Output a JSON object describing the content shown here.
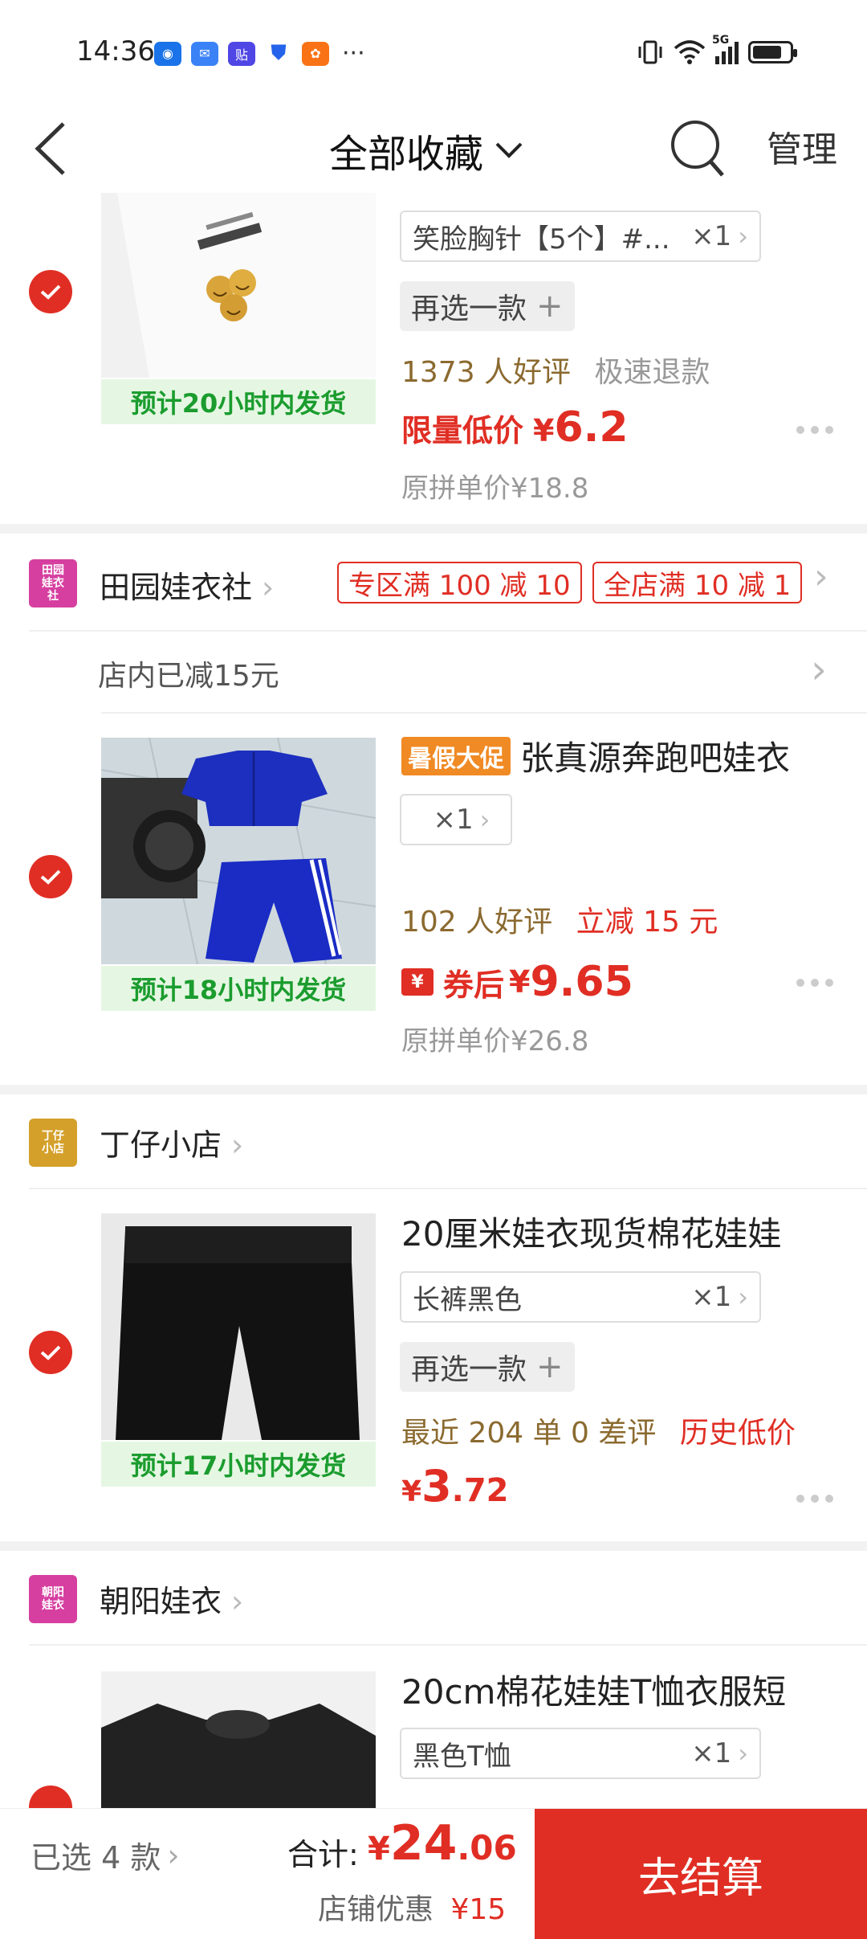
{
  "status_bar": {
    "time": "14:36",
    "dots": "···",
    "network": "5G"
  },
  "header": {
    "title": "全部收藏",
    "manage_label": "管理"
  },
  "products": [
    {
      "spec": "笑脸胸针【5个】#...",
      "qty": "×1",
      "reselect": "再选一款",
      "shipping": "预计20小时内发货",
      "rating": "1373 人好评",
      "rating_tag": "极速退款",
      "price_label": "限量低价",
      "currency": "¥",
      "price": "6.2",
      "original": "原拼单价¥18.8"
    },
    {
      "badge": "暑假大促",
      "title": "张真源奔跑吧娃衣",
      "qty": "×1",
      "shipping": "预计18小时内发货",
      "rating": "102 人好评",
      "rating_tag": "立减 15 元",
      "price_label": "券后",
      "currency": "¥",
      "price": "9.65",
      "original": "原拼单价¥26.8"
    },
    {
      "title": "20厘米娃衣现货棉花娃娃",
      "spec": "长裤黑色",
      "qty": "×1",
      "reselect": "再选一款",
      "shipping": "预计17小时内发货",
      "rating": "最近 204 单 0 差评",
      "rating_tag": "历史低价",
      "currency": "¥",
      "price_int": "3",
      "price_dec": ".72"
    },
    {
      "title": "20cm棉花娃娃T恤衣服短",
      "spec": "黑色T恤",
      "qty": "×1"
    }
  ],
  "stores": [
    {
      "logo_text": "田园娃衣社",
      "name": "田园娃衣社",
      "promo_1": "专区满 100 减 10",
      "promo_2": "全店满 10 减 1",
      "saved": "店内已减15元",
      "logo_color": "#d63fa0"
    },
    {
      "logo_text": "丁仔小店",
      "name": "丁仔小店",
      "logo_color": "#d4a02a"
    },
    {
      "logo_text": "朝阳娃衣",
      "name": "朝阳娃衣",
      "logo_color": "#d63fa0"
    }
  ],
  "bottom": {
    "selected": "已选 4 款",
    "total_label": "合计:",
    "currency": "¥",
    "total_int": "24",
    "total_dec": ".06",
    "discount_label": "店铺优惠",
    "discount_value": "¥15",
    "checkout": "去结算"
  },
  "colors": {
    "accent": "#e02e24",
    "ship_green": "#1b9c2e",
    "rating_brown": "#8b6a2f"
  }
}
